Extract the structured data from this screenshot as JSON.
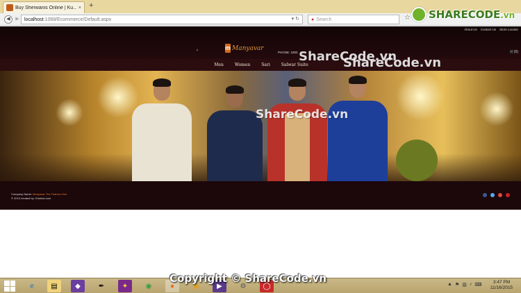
{
  "browser": {
    "tab_title": "Buy Sherwanis Online | Ku...",
    "tab_close": "×",
    "new_tab": "+",
    "url_host": "localhost",
    "url_path": ":1068/Ecommerce/Default.aspx",
    "search_placeholder": "Search"
  },
  "site": {
    "top_links": [
      "About Us",
      "Contact Us",
      "Store Locator"
    ],
    "logo_letter": "m",
    "logo_text": "Manyavar",
    "phone": "PHONE: 1800",
    "cart_count": "(0)",
    "menu": [
      "Men",
      "Women",
      "Sari",
      "Salwar Suite"
    ],
    "footer": {
      "company_label": "Company Name:",
      "company_name": "Manyavar The Fashion Hub",
      "copyright": "© 2015 created by: Krishna soni"
    }
  },
  "watermarks": {
    "logo_main": "SHARECODE",
    "logo_suffix": ".vn",
    "text1": "ShareCode.vn",
    "text2": "ShareCode.vn",
    "text3": "ShareCode.vn",
    "copyright": "Copyright © ShareCode.vn"
  },
  "taskbar": {
    "time": "3:47 PM",
    "date": "11/16/2015"
  },
  "colors": {
    "site_bg": "#1c070a",
    "menu_bg": "#2b0d10",
    "accent": "#d06a1e",
    "taskbar": "#c9b988"
  }
}
